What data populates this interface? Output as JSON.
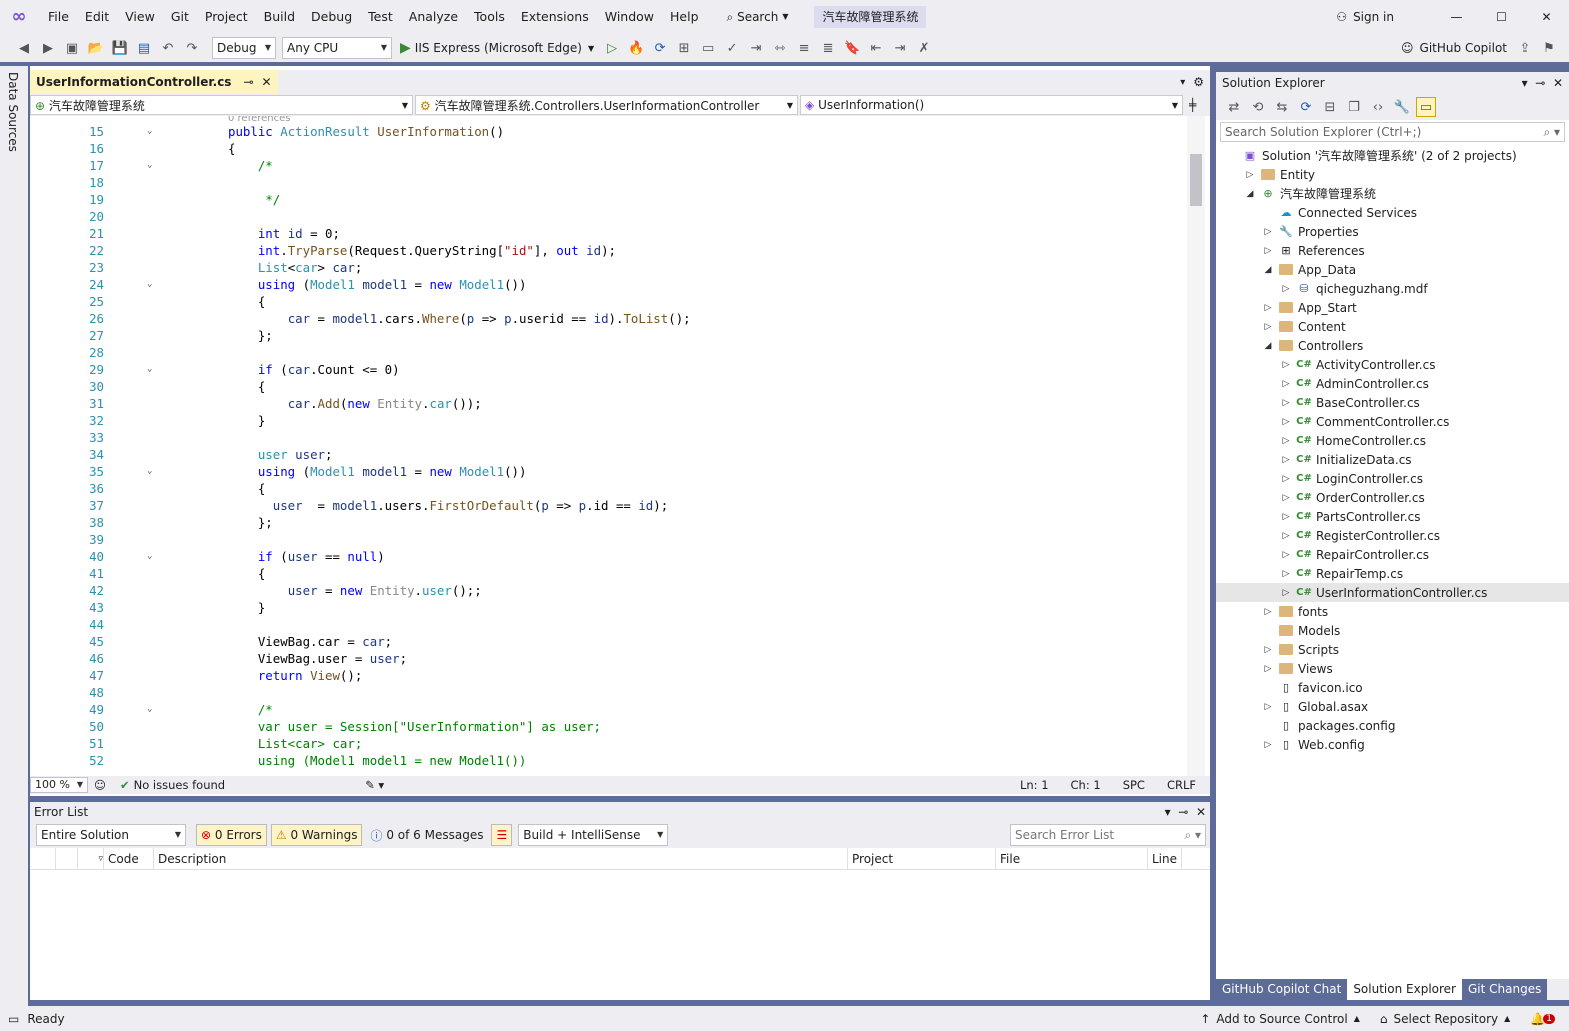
{
  "menu": [
    "File",
    "Edit",
    "View",
    "Git",
    "Project",
    "Build",
    "Debug",
    "Test",
    "Analyze",
    "Tools",
    "Extensions",
    "Window",
    "Help"
  ],
  "title": {
    "search": "Search",
    "solution_name": "汽车故障管理系统",
    "sign_in": "Sign in"
  },
  "toolbar": {
    "config": "Debug",
    "platform": "Any CPU",
    "run_target": "IIS Express (Microsoft Edge)",
    "copilot": "GitHub Copilot"
  },
  "left_strip": "Data Sources",
  "editor": {
    "tab_title": "UserInformationController.cs",
    "nav_project": "汽车故障管理系统",
    "nav_class": "汽车故障管理系统.Controllers.UserInformationController",
    "nav_member": "UserInformation()",
    "codelens": "0 references",
    "zoom": "100 %",
    "issues": "No issues found",
    "ln": "Ln: 1",
    "ch": "Ch: 1",
    "spc": "SPC",
    "crlf": "CRLF"
  },
  "code_lines": [
    {
      "n": "15",
      "fold": true,
      "html": "<span class='kw'>public</span> <span class='ty'>ActionResult</span> <span class='me'>UserInformation</span>()"
    },
    {
      "n": "16",
      "html": "{"
    },
    {
      "n": "17",
      "fold": true,
      "html": "    <span class='cm'>/*</span>"
    },
    {
      "n": "18",
      "html": ""
    },
    {
      "n": "19",
      "html": "     <span class='cm'>*/</span>"
    },
    {
      "n": "20",
      "html": ""
    },
    {
      "n": "21",
      "html": "    <span class='kw'>int</span> <span class='pa'>id</span> = 0;"
    },
    {
      "n": "22",
      "html": "    <span class='kw'>int</span>.<span class='me'>TryParse</span>(Request.QueryString[<span class='str'>\"id\"</span>], <span class='kw'>out</span> <span class='pa'>id</span>);"
    },
    {
      "n": "23",
      "html": "    <span class='ty'>List</span>&lt;<span class='ty'>car</span>&gt; <span class='pa'>car</span>;"
    },
    {
      "n": "24",
      "fold": true,
      "html": "    <span class='kw'>using</span> (<span class='ty'>Model1</span> <span class='pa'>model1</span> = <span class='kw'>new</span> <span class='ty'>Model1</span>())"
    },
    {
      "n": "25",
      "html": "    {"
    },
    {
      "n": "26",
      "html": "        <span class='pa'>car</span> = <span class='pa'>model1</span>.cars.<span class='me'>Where</span>(<span class='pa'>p</span> =&gt; <span class='pa'>p</span>.userid == <span class='pa'>id</span>).<span class='me'>ToList</span>();"
    },
    {
      "n": "27",
      "html": "    };"
    },
    {
      "n": "28",
      "html": ""
    },
    {
      "n": "29",
      "fold": true,
      "html": "    <span class='kw'>if</span> (<span class='pa'>car</span>.Count &lt;= 0)"
    },
    {
      "n": "30",
      "html": "    {"
    },
    {
      "n": "31",
      "html": "        <span class='pa'>car</span>.<span class='me'>Add</span>(<span class='kw'>new</span> <span class='gr'>Entity</span>.<span class='ty'>car</span>());"
    },
    {
      "n": "32",
      "html": "    }"
    },
    {
      "n": "33",
      "html": ""
    },
    {
      "n": "34",
      "html": "    <span class='ty'>user</span> <span class='pa'>user</span>;"
    },
    {
      "n": "35",
      "fold": true,
      "html": "    <span class='kw'>using</span> (<span class='ty'>Model1</span> <span class='pa'>model1</span> = <span class='kw'>new</span> <span class='ty'>Model1</span>())"
    },
    {
      "n": "36",
      "html": "    {"
    },
    {
      "n": "37",
      "html": "      <span class='pa'>user</span>  = <span class='pa'>model1</span>.users.<span class='me'>FirstOrDefault</span>(<span class='pa'>p</span> =&gt; <span class='pa'>p</span>.id == <span class='pa'>id</span>);"
    },
    {
      "n": "38",
      "html": "    };"
    },
    {
      "n": "39",
      "html": ""
    },
    {
      "n": "40",
      "fold": true,
      "html": "    <span class='kw'>if</span> (<span class='pa'>user</span> == <span class='kw'>null</span>)"
    },
    {
      "n": "41",
      "html": "    {"
    },
    {
      "n": "42",
      "html": "        <span class='pa'>user</span> = <span class='kw'>new</span> <span class='gr'>Entity</span>.<span class='ty'>user</span>();;"
    },
    {
      "n": "43",
      "html": "    }"
    },
    {
      "n": "44",
      "html": ""
    },
    {
      "n": "45",
      "html": "    ViewBag.car = <span class='pa'>car</span>;"
    },
    {
      "n": "46",
      "html": "    ViewBag.user = <span class='pa'>user</span>;"
    },
    {
      "n": "47",
      "html": "    <span class='kw'>return</span> <span class='me'>View</span>();"
    },
    {
      "n": "48",
      "html": ""
    },
    {
      "n": "49",
      "fold": true,
      "html": "    <span class='cm'>/*</span>"
    },
    {
      "n": "50",
      "html": "    <span class='cm'>var user = Session[\"UserInformation\"] as user;</span>"
    },
    {
      "n": "51",
      "html": "    <span class='cm'>List&lt;car&gt; car;</span>"
    },
    {
      "n": "52",
      "html": "    <span class='cm'>using (Model1 model1 = new Model1())</span>"
    }
  ],
  "error_list": {
    "title": "Error List",
    "scope": "Entire Solution",
    "errors": "0 Errors",
    "warnings": "0 Warnings",
    "messages": "0 of 6 Messages",
    "build": "Build + IntelliSense",
    "search_placeholder": "Search Error List",
    "columns": [
      "Code",
      "Description",
      "Project",
      "File",
      "Line"
    ]
  },
  "solution_explorer": {
    "title": "Solution Explorer",
    "search_placeholder": "Search Solution Explorer (Ctrl+;)",
    "items": [
      {
        "label": "Solution '汽车故障管理系统' (2 of 2 projects)",
        "indent": 0,
        "exp": "",
        "icon": "solution"
      },
      {
        "label": "Entity",
        "indent": 1,
        "exp": "▷",
        "icon": "folder"
      },
      {
        "label": "汽车故障管理系统",
        "indent": 1,
        "exp": "◢",
        "icon": "web"
      },
      {
        "label": "Connected Services",
        "indent": 2,
        "exp": "",
        "icon": "cloud"
      },
      {
        "label": "Properties",
        "indent": 2,
        "exp": "▷",
        "icon": "wrench"
      },
      {
        "label": "References",
        "indent": 2,
        "exp": "▷",
        "icon": "ref"
      },
      {
        "label": "App_Data",
        "indent": 2,
        "exp": "◢",
        "icon": "folder"
      },
      {
        "label": "qicheguzhang.mdf",
        "indent": 3,
        "exp": "▷",
        "icon": "db"
      },
      {
        "label": "App_Start",
        "indent": 2,
        "exp": "▷",
        "icon": "folder"
      },
      {
        "label": "Content",
        "indent": 2,
        "exp": "▷",
        "icon": "folder"
      },
      {
        "label": "Controllers",
        "indent": 2,
        "exp": "◢",
        "icon": "folder"
      },
      {
        "label": "ActivityController.cs",
        "indent": 3,
        "exp": "▷",
        "icon": "cs"
      },
      {
        "label": "AdminController.cs",
        "indent": 3,
        "exp": "▷",
        "icon": "cs"
      },
      {
        "label": "BaseController.cs",
        "indent": 3,
        "exp": "▷",
        "icon": "cs"
      },
      {
        "label": "CommentController.cs",
        "indent": 3,
        "exp": "▷",
        "icon": "cs"
      },
      {
        "label": "HomeController.cs",
        "indent": 3,
        "exp": "▷",
        "icon": "cs"
      },
      {
        "label": "InitializeData.cs",
        "indent": 3,
        "exp": "▷",
        "icon": "cs"
      },
      {
        "label": "LoginController.cs",
        "indent": 3,
        "exp": "▷",
        "icon": "cs"
      },
      {
        "label": "OrderController.cs",
        "indent": 3,
        "exp": "▷",
        "icon": "cs"
      },
      {
        "label": "PartsController.cs",
        "indent": 3,
        "exp": "▷",
        "icon": "cs"
      },
      {
        "label": "RegisterController.cs",
        "indent": 3,
        "exp": "▷",
        "icon": "cs"
      },
      {
        "label": "RepairController.cs",
        "indent": 3,
        "exp": "▷",
        "icon": "cs"
      },
      {
        "label": "RepairTemp.cs",
        "indent": 3,
        "exp": "▷",
        "icon": "cs"
      },
      {
        "label": "UserInformationController.cs",
        "indent": 3,
        "exp": "▷",
        "icon": "cs",
        "selected": true
      },
      {
        "label": "fonts",
        "indent": 2,
        "exp": "▷",
        "icon": "folder"
      },
      {
        "label": "Models",
        "indent": 2,
        "exp": "",
        "icon": "folder"
      },
      {
        "label": "Scripts",
        "indent": 2,
        "exp": "▷",
        "icon": "folder"
      },
      {
        "label": "Views",
        "indent": 2,
        "exp": "▷",
        "icon": "folder"
      },
      {
        "label": "favicon.ico",
        "indent": 2,
        "exp": "",
        "icon": "file"
      },
      {
        "label": "Global.asax",
        "indent": 2,
        "exp": "▷",
        "icon": "file"
      },
      {
        "label": "packages.config",
        "indent": 2,
        "exp": "",
        "icon": "file"
      },
      {
        "label": "Web.config",
        "indent": 2,
        "exp": "▷",
        "icon": "file"
      }
    ],
    "tabs": [
      "GitHub Copilot Chat",
      "Solution Explorer",
      "Git Changes"
    ]
  },
  "status": {
    "ready": "Ready",
    "add_source": "Add to Source Control",
    "select_repo": "Select Repository",
    "notif_count": "1"
  }
}
